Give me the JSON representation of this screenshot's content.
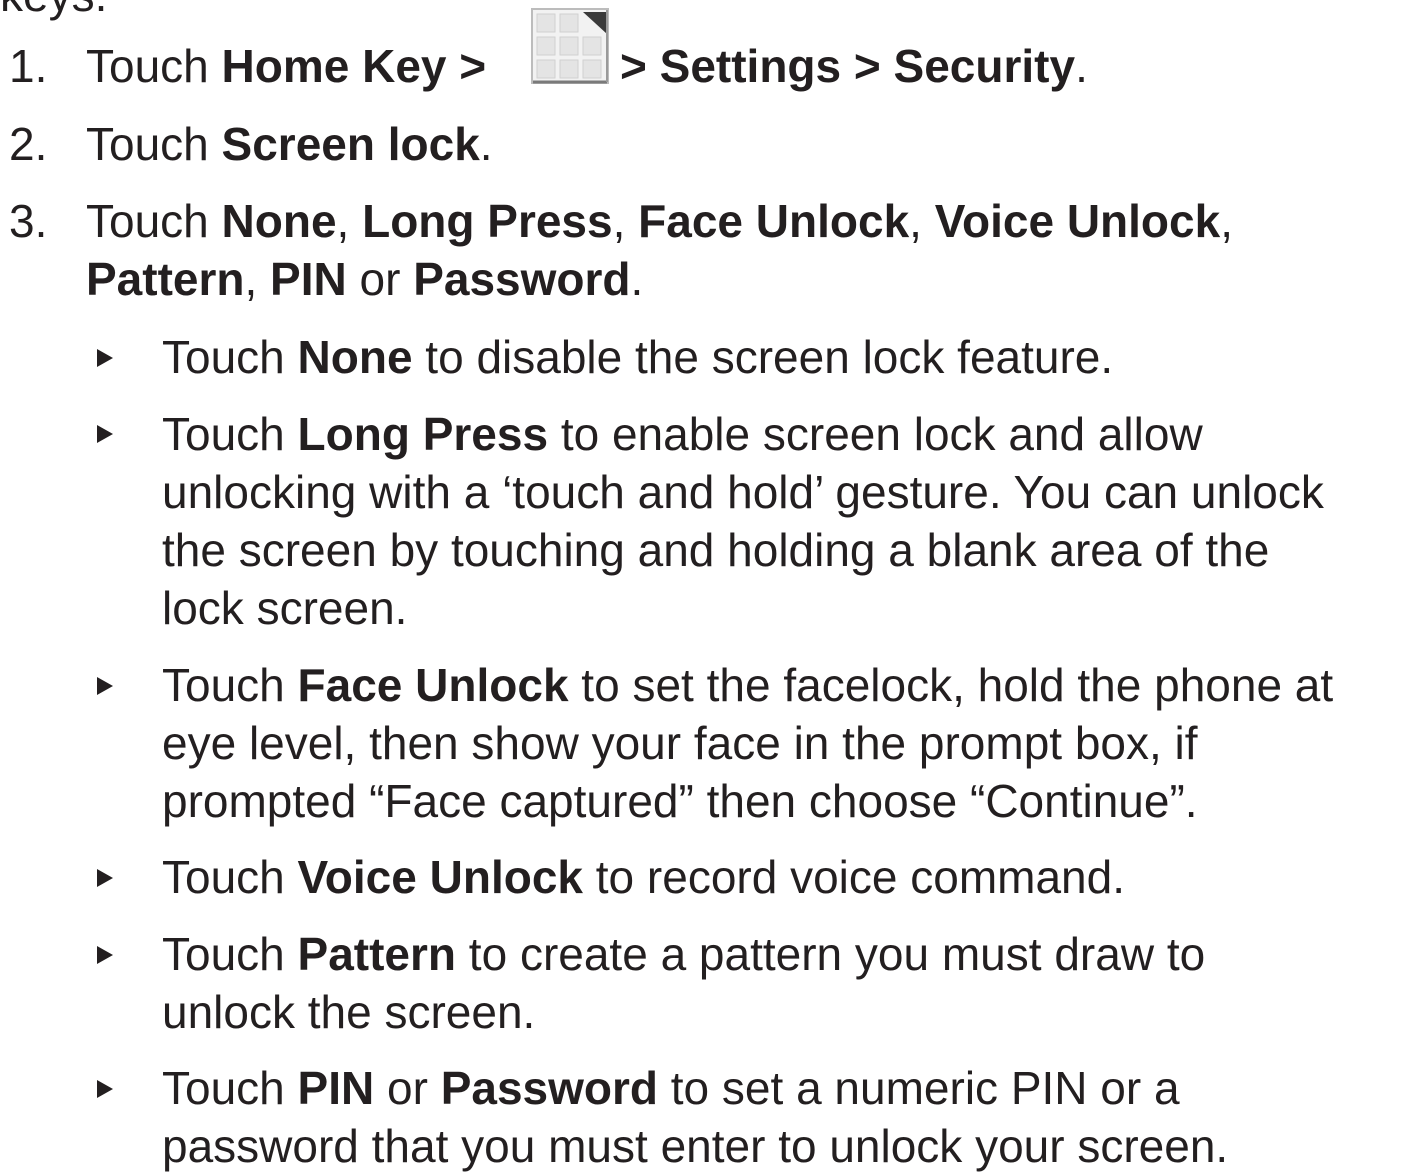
{
  "header_fragment": "keys.",
  "steps": [
    {
      "number": "1.",
      "prefix": "Touch ",
      "b1": "Home Key >",
      "b2": " > Settings > Security",
      "end": ".",
      "icon": "apps-grid-icon"
    },
    {
      "number": "2.",
      "prefix": "Touch ",
      "b1": "Screen lock",
      "end": "."
    },
    {
      "number": "3.",
      "prefix": "Touch ",
      "b1": "None",
      "s1": ", ",
      "b2": "Long Press",
      "s2": ", ",
      "b3": "Face Unlock",
      "s3": ", ",
      "b4": "Voice Unlock",
      "s4": ",",
      "b5": "Pattern",
      "s5": ", ",
      "b6": "PIN",
      "s6": " or ",
      "b7": "Password",
      "end": "."
    }
  ],
  "bullets": [
    {
      "prefix": "Touch ",
      "bold": "None",
      "lines": [
        " to disable the screen lock feature."
      ]
    },
    {
      "prefix": "Touch ",
      "bold": "Long Press",
      "lines": [
        " to enable screen lock and allow",
        "unlocking with a ‘touch and hold’ gesture. You can unlock",
        "the screen by touching and holding a blank area of the",
        "lock screen."
      ]
    },
    {
      "prefix": "Touch ",
      "bold": "Face Unlock",
      "lines": [
        " to set the facelock, hold the phone at",
        "eye level, then show your face in the prompt box, if",
        "prompted “Face captured” then choose “Continue”."
      ]
    },
    {
      "prefix": "Touch ",
      "bold": "Voice Unlock",
      "lines": [
        " to record voice command."
      ]
    },
    {
      "prefix": "Touch ",
      "bold": "Pattern",
      "lines": [
        " to create a pattern you must draw to",
        "unlock the screen."
      ]
    },
    {
      "prefix": "Touch ",
      "bold": "PIN",
      "mid": " or ",
      "bold2": "Password",
      "lines": [
        " to set a numeric PIN or a",
        "password that you must enter to unlock your screen."
      ]
    }
  ]
}
